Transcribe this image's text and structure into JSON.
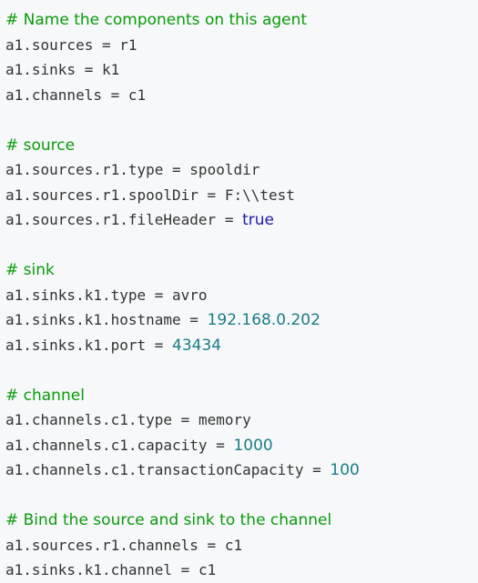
{
  "code": {
    "lines": [
      {
        "kind": "comment",
        "text": "# Name the components on this agent"
      },
      {
        "kind": "kv",
        "key": "a1.sources",
        "op": " = ",
        "value": "r1",
        "vtype": "plain"
      },
      {
        "kind": "kv",
        "key": "a1.sinks",
        "op": " = ",
        "value": "k1",
        "vtype": "plain"
      },
      {
        "kind": "kv",
        "key": "a1.channels",
        "op": " = ",
        "value": "c1",
        "vtype": "plain"
      },
      {
        "kind": "blank"
      },
      {
        "kind": "comment",
        "text": "# source"
      },
      {
        "kind": "kv",
        "key": "a1.sources.r1.type",
        "op": " = ",
        "value": "spooldir",
        "vtype": "plain"
      },
      {
        "kind": "kv",
        "key": "a1.sources.r1.spoolDir",
        "op": " = ",
        "value": "F:\\\\test",
        "vtype": "plain"
      },
      {
        "kind": "kv",
        "key": "a1.sources.r1.fileHeader",
        "op": " = ",
        "value": "true",
        "vtype": "bool"
      },
      {
        "kind": "blank"
      },
      {
        "kind": "comment",
        "text": "# sink"
      },
      {
        "kind": "kv",
        "key": "a1.sinks.k1.type",
        "op": " = ",
        "value": "avro",
        "vtype": "plain"
      },
      {
        "kind": "kv",
        "key": "a1.sinks.k1.hostname",
        "op": " = ",
        "value": "192.168.0.202",
        "vtype": "num"
      },
      {
        "kind": "kv",
        "key": "a1.sinks.k1.port",
        "op": " = ",
        "value": "43434",
        "vtype": "num"
      },
      {
        "kind": "blank"
      },
      {
        "kind": "comment",
        "text": "# channel"
      },
      {
        "kind": "kv",
        "key": "a1.channels.c1.type",
        "op": " = ",
        "value": "memory",
        "vtype": "plain"
      },
      {
        "kind": "kv",
        "key": "a1.channels.c1.capacity",
        "op": " = ",
        "value": "1000",
        "vtype": "num"
      },
      {
        "kind": "kv",
        "key": "a1.channels.c1.transactionCapacity",
        "op": " = ",
        "value": "100",
        "vtype": "num"
      },
      {
        "kind": "blank"
      },
      {
        "kind": "comment",
        "text": "# Bind the source and sink to the channel"
      },
      {
        "kind": "kv",
        "key": "a1.sources.r1.channels",
        "op": " = ",
        "value": "c1",
        "vtype": "plain"
      },
      {
        "kind": "kv",
        "key": "a1.sinks.k1.channel",
        "op": " = ",
        "value": "c1",
        "vtype": "plain"
      }
    ]
  },
  "colors": {
    "background": "#f6f8fa",
    "text": "#333333",
    "comment": "#0a9b0a",
    "number": "#1a7d84",
    "boolean": "#1c1ca8"
  }
}
